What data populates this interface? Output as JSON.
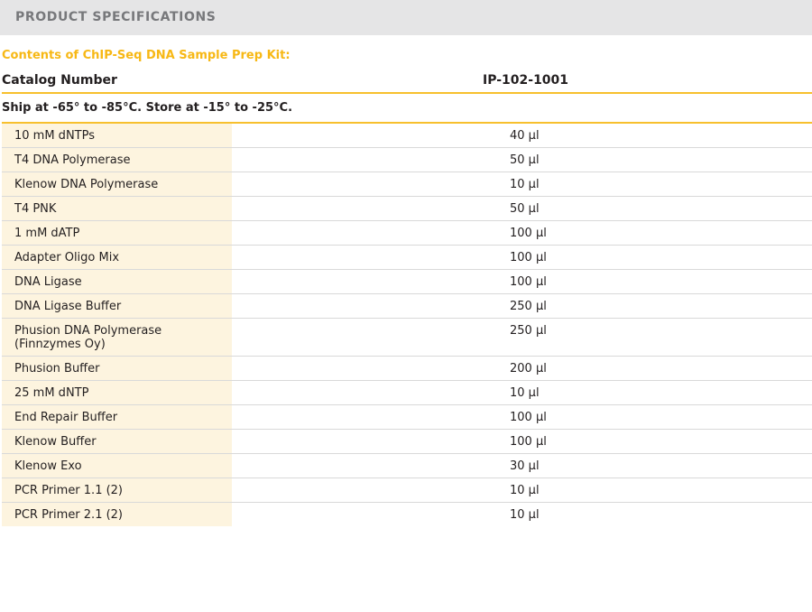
{
  "header": {
    "title": "PRODUCT SPECIFICATIONS"
  },
  "kit_title": "Contents of ChIP-Seq DNA Sample Prep Kit:",
  "catalog": {
    "label": "Catalog Number",
    "value": "IP-102-1001"
  },
  "shipping": "Ship at -65° to -85°C. Store at -15° to -25°C.",
  "colors": {
    "header_bg": "#e5e5e6",
    "header_text": "#77787b",
    "accent": "#f7b815",
    "label_cell_bg": "#fdf4df",
    "row_divider": "#d9d9d9"
  },
  "items": [
    {
      "name": "10 mM dNTPs",
      "volume": "40 µl"
    },
    {
      "name": "T4 DNA Polymerase",
      "volume": "50 µl"
    },
    {
      "name": "Klenow DNA Polymerase",
      "volume": "10 µl"
    },
    {
      "name": "T4 PNK",
      "volume": "50 µl"
    },
    {
      "name": "1 mM dATP",
      "volume": "100 µl"
    },
    {
      "name": "Adapter Oligo Mix",
      "volume": "100 µl"
    },
    {
      "name": "DNA Ligase",
      "volume": "100 µl"
    },
    {
      "name": "DNA Ligase Buffer",
      "volume": "250 µl"
    },
    {
      "name": "Phusion DNA Polymerase\n(Finnzymes Oy)",
      "volume": "250 µl"
    },
    {
      "name": "Phusion Buffer",
      "volume": "200 µl"
    },
    {
      "name": "25 mM dNTP",
      "volume": "10 µl"
    },
    {
      "name": "End Repair Buffer",
      "volume": "100 µl"
    },
    {
      "name": "Klenow Buffer",
      "volume": "100 µl"
    },
    {
      "name": "Klenow Exo",
      "volume": "30 µl"
    },
    {
      "name": "PCR Primer 1.1 (2)",
      "volume": "10 µl"
    },
    {
      "name": "PCR Primer 2.1 (2)",
      "volume": "10 µl"
    }
  ]
}
